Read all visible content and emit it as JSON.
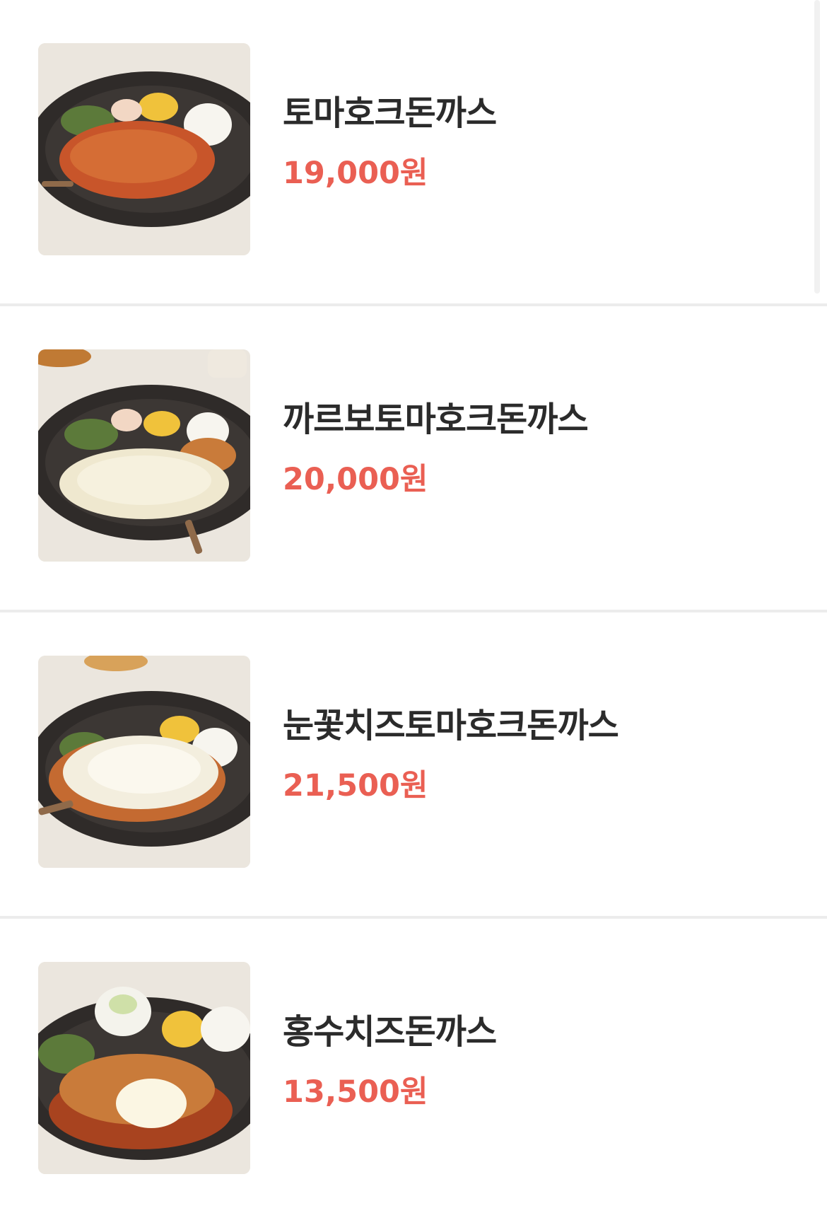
{
  "menu": {
    "items": [
      {
        "name": "토마호크돈까스",
        "price": "19,000원",
        "image_icon": "tomahawk-tonkatsu-photo",
        "sauce": "#c8552a"
      },
      {
        "name": "까르보토마호크돈까스",
        "price": "20,000원",
        "image_icon": "carbonara-tomahawk-tonkatsu-photo",
        "sauce": "#efe8cf"
      },
      {
        "name": "눈꽃치즈토마호크돈까스",
        "price": "21,500원",
        "image_icon": "snow-cheese-tomahawk-tonkatsu-photo",
        "sauce": "#f3eede"
      },
      {
        "name": "홍수치즈돈까스",
        "price": "13,500원",
        "image_icon": "cheese-flood-tonkatsu-photo",
        "sauce": "#a8431f"
      }
    ]
  },
  "colors": {
    "price": "#ea5f53",
    "name": "#2b2b2b",
    "divider": "#ececec"
  }
}
